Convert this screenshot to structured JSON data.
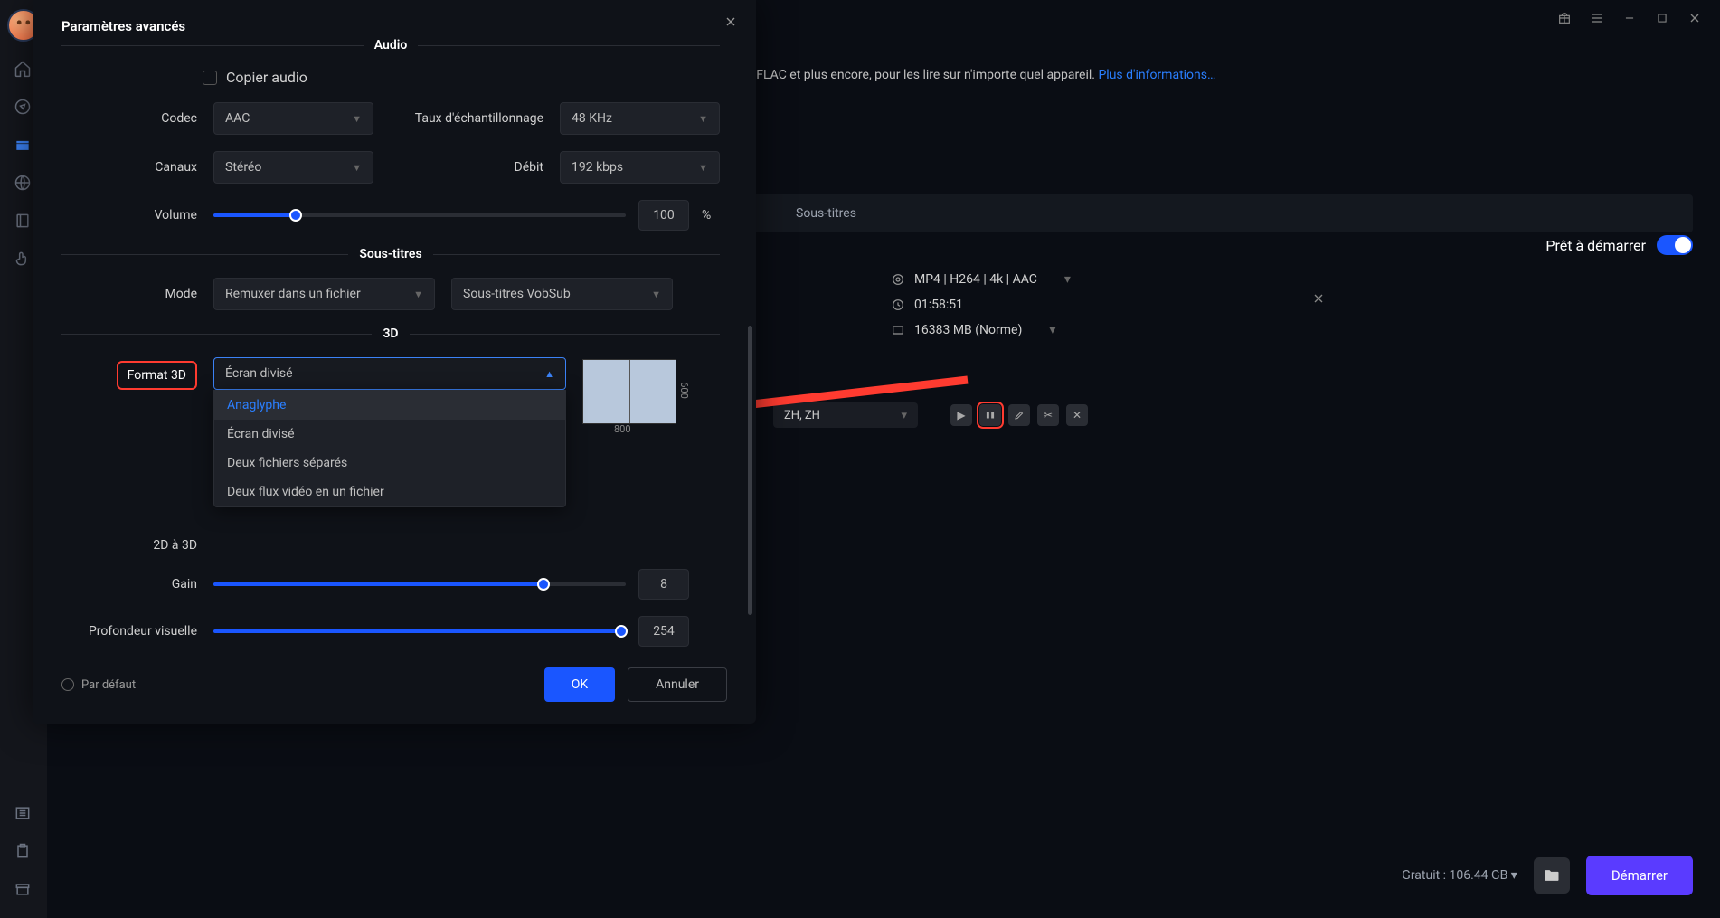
{
  "titlebar": {
    "icons": [
      "gift",
      "menu",
      "minimize",
      "maximize",
      "close"
    ]
  },
  "rail": {
    "icons": [
      "home",
      "compass",
      "box",
      "globe",
      "book",
      "hand"
    ],
    "bottom_icons": [
      "list",
      "clipboard",
      "archive"
    ],
    "active_index": 2
  },
  "bg": {
    "desc_text": ", FLAC et plus encore, pour les lire sur n'importe quel appareil. ",
    "desc_link": "Plus d'informations…",
    "tab_subtitles": "Sous-titres",
    "ready_label": "Prêt à démarrer",
    "file": {
      "format": "MP4 | H264 | 4k | AAC",
      "duration": "01:58:51",
      "size": "16383 MB (Norme)"
    },
    "lang": "ZH, ZH",
    "footer": {
      "free": "Gratuit : 106.44 GB",
      "start": "Démarrer"
    }
  },
  "modal": {
    "title": "Paramètres avancés",
    "audio": {
      "section": "Audio",
      "copy_label": "Copier audio",
      "codec_label": "Codec",
      "codec_value": "AAC",
      "rate_label": "Taux d'échantillonnage",
      "rate_value": "48 KHz",
      "channels_label": "Canaux",
      "channels_value": "Stéréo",
      "bitrate_label": "Débit",
      "bitrate_value": "192 kbps",
      "volume_label": "Volume",
      "volume_value": "100",
      "volume_unit": "%"
    },
    "subs": {
      "section": "Sous-titres",
      "mode_label": "Mode",
      "mode_value": "Remuxer dans un fichier",
      "type_value": "Sous-titres VobSub"
    },
    "three_d": {
      "section": "3D",
      "format_label": "Format 3D",
      "format_value": "Écran divisé",
      "options": [
        "Anaglyphe",
        "Écran divisé",
        "Deux fichiers séparés",
        "Deux flux vidéo en un fichier"
      ],
      "preview": {
        "w": "800",
        "h": "600"
      },
      "conv_label": "2D à 3D",
      "gain_label": "Gain",
      "gain_value": "8",
      "depth_label": "Profondeur visuelle",
      "depth_value": "254"
    },
    "footer": {
      "default_label": "Par défaut",
      "ok": "OK",
      "cancel": "Annuler"
    }
  }
}
